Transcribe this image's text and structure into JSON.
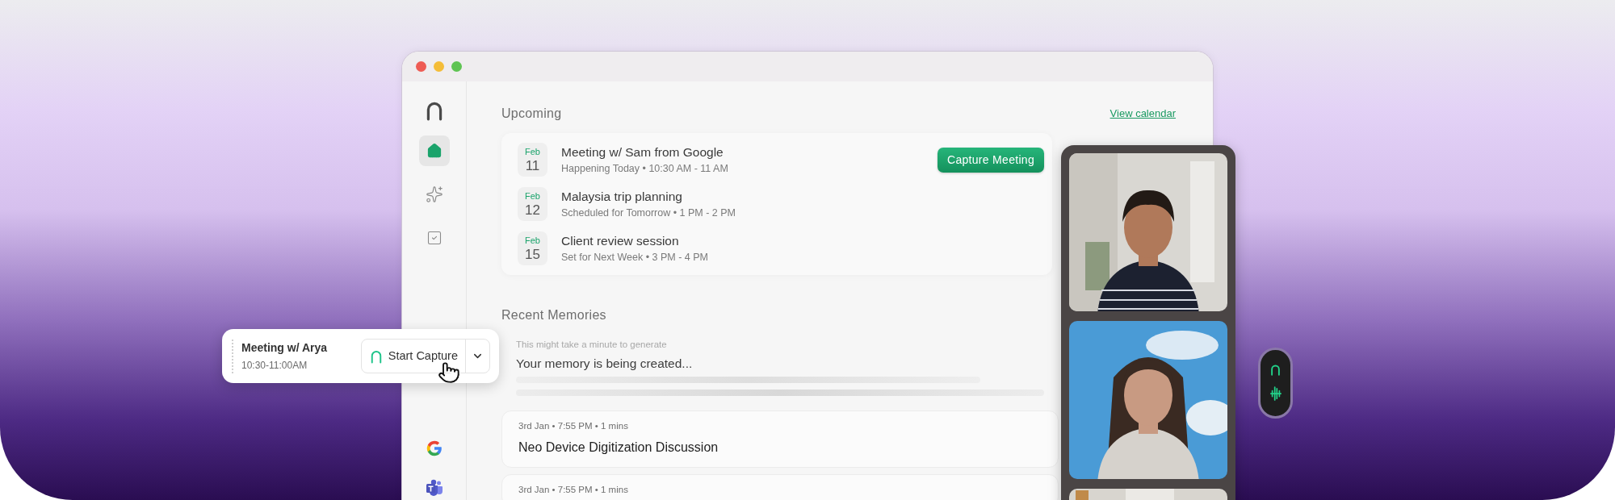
{
  "sidebar": {
    "items": [
      {
        "kind": "home",
        "selected": true
      },
      {
        "kind": "sparkles",
        "selected": false
      },
      {
        "kind": "tasks",
        "selected": false
      }
    ],
    "integrations": [
      {
        "kind": "google"
      },
      {
        "kind": "teams"
      }
    ]
  },
  "upcoming": {
    "title": "Upcoming",
    "link": "View calendar",
    "events": [
      {
        "month": "Feb",
        "day": "11",
        "title": "Meeting w/ Sam from Google",
        "subtitle": "Happening Today • 10:30 AM - 11 AM",
        "action": "Capture Meeting"
      },
      {
        "month": "Feb",
        "day": "12",
        "title": "Malaysia trip planning",
        "subtitle": "Scheduled for Tomorrow • 1 PM - 2 PM"
      },
      {
        "month": "Feb",
        "day": "15",
        "title": "Client review session",
        "subtitle": "Set for Next Week • 3 PM - 4 PM"
      }
    ]
  },
  "memories": {
    "title": "Recent Memories",
    "pending": {
      "hint": "This might take a minute to generate",
      "message": "Your memory is being created..."
    },
    "items": [
      {
        "meta": "3rd Jan • 7:55 PM • 1 mins",
        "title": "Neo Device Digitization Discussion"
      },
      {
        "meta": "3rd Jan • 7:55 PM • 1 mins"
      }
    ]
  },
  "popup": {
    "title": "Meeting w/ Arya",
    "time": "10:30-11:00AM",
    "button": "Start Capture"
  }
}
